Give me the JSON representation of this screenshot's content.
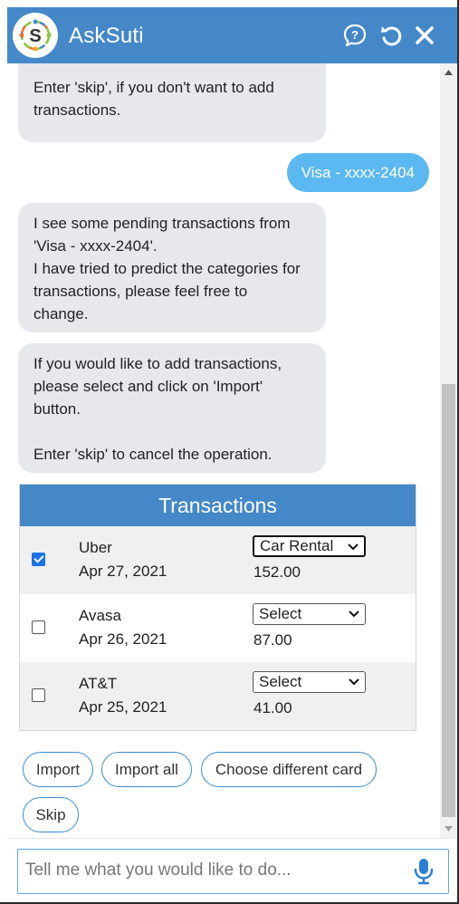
{
  "header": {
    "title": "AskSuti",
    "logo_icon": "asksuti-logo",
    "icons": [
      "help-chat-icon",
      "refresh-icon",
      "close-icon"
    ],
    "bg_color": "#4488c8"
  },
  "messages": {
    "bot1": {
      "lines": [
        "Enter 'skip', if you don't want to add",
        "transactions."
      ]
    },
    "user1": {
      "text": "Visa - xxxx-2404"
    },
    "bot2": {
      "lines": [
        "I see some pending transactions from",
        "'Visa - xxxx-2404'.",
        "I have tried to predict the categories for",
        "transactions, please feel free to",
        "change."
      ]
    },
    "bot3": {
      "lines": [
        "If you would like to add transactions,",
        "please select and click on 'Import'",
        "button.",
        "",
        "Enter 'skip' to cancel the operation."
      ]
    }
  },
  "transactions": {
    "title": "Transactions",
    "rows": [
      {
        "checked": true,
        "name": "Uber",
        "date": "Apr 27, 2021",
        "category": "Car Rental",
        "amount": "152.00"
      },
      {
        "checked": false,
        "name": "Avasa",
        "date": "Apr 26, 2021",
        "category": "Select",
        "amount": "87.00"
      },
      {
        "checked": false,
        "name": "AT&T",
        "date": "Apr 25, 2021",
        "category": "Select",
        "amount": "41.00"
      }
    ]
  },
  "actions": {
    "import": "Import",
    "import_all": "Import all",
    "choose_card": "Choose different card",
    "skip": "Skip"
  },
  "input": {
    "placeholder": "Tell me what you would like to do...",
    "value": "",
    "mic_icon": "microphone-icon"
  },
  "colors": {
    "accent": "#4488c8",
    "user_bubble": "#5cb8f0",
    "bot_bubble": "#e6e8ec",
    "button_border": "#3d8bd4"
  }
}
